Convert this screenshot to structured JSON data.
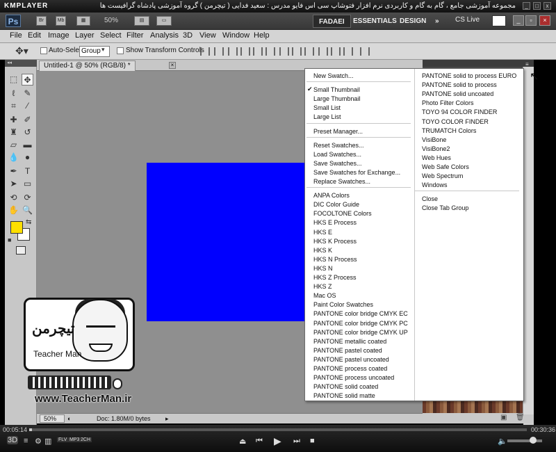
{
  "player": {
    "logo": "KMPLAYER",
    "title": "مجموعه آموزشی جامع ، گام به گام و کاربردی نرم افزار فتوشاپ سی اس فایو مدرس : سعید فدایی ( تیچرمن ) گروه آموزشی پادشاه گرافیست ها",
    "time_elapsed": "00:05:14",
    "time_total": "00:30:36",
    "formats": [
      "FLV",
      "MP3",
      "3D",
      "2CH"
    ]
  },
  "appbar": {
    "logo": "Ps",
    "br": "Br",
    "mb": "Mb",
    "zoom": "50%",
    "workspaces": [
      "FADAEI",
      "ESSENTIALS",
      "DESIGN"
    ],
    "more": "»",
    "cs_live": "CS Live"
  },
  "menubar": [
    "File",
    "Edit",
    "Image",
    "Layer",
    "Select",
    "Filter",
    "Analysis",
    "3D",
    "View",
    "Window",
    "Help"
  ],
  "options": {
    "auto_select_label": "Auto-Select:",
    "auto_select_value": "Group",
    "show_transform_label": "Show Transform Controls"
  },
  "document": {
    "tab_title": "Untitled-1 @ 50% (RGB/8) *",
    "zoom": "50%",
    "doc_info": "Doc: 1.80M/0 bytes",
    "canvas_color": "#0000ff"
  },
  "colors": {
    "foreground": "#ffe000",
    "background": "#ffffff"
  },
  "flyout": {
    "col1": [
      {
        "label": "New Swatch...",
        "sep_after": true
      },
      {
        "label": "Small Thumbnail",
        "checked": true
      },
      {
        "label": "Large Thumbnail"
      },
      {
        "label": "Small List"
      },
      {
        "label": "Large List",
        "sep_after": true
      },
      {
        "label": "Preset Manager...",
        "sep_after": true
      },
      {
        "label": "Reset Swatches..."
      },
      {
        "label": "Load Swatches..."
      },
      {
        "label": "Save Swatches..."
      },
      {
        "label": "Save Swatches for Exchange..."
      },
      {
        "label": "Replace Swatches...",
        "sep_after": true
      },
      {
        "label": "ANPA Colors"
      },
      {
        "label": "DIC Color Guide"
      },
      {
        "label": "FOCOLTONE Colors"
      },
      {
        "label": "HKS E Process"
      },
      {
        "label": "HKS E"
      },
      {
        "label": "HKS K Process"
      },
      {
        "label": "HKS K"
      },
      {
        "label": "HKS N Process"
      },
      {
        "label": "HKS N"
      },
      {
        "label": "HKS Z Process"
      },
      {
        "label": "HKS Z"
      },
      {
        "label": "Mac OS"
      },
      {
        "label": "Paint Color Swatches"
      },
      {
        "label": "PANTONE color bridge CMYK EC"
      },
      {
        "label": "PANTONE color bridge CMYK PC"
      },
      {
        "label": "PANTONE color bridge CMYK UP"
      },
      {
        "label": "PANTONE metallic coated"
      },
      {
        "label": "PANTONE pastel coated"
      },
      {
        "label": "PANTONE pastel uncoated"
      },
      {
        "label": "PANTONE process coated"
      },
      {
        "label": "PANTONE process uncoated"
      },
      {
        "label": "PANTONE solid coated"
      },
      {
        "label": "PANTONE solid matte"
      }
    ],
    "col2": [
      {
        "label": "PANTONE solid to process EURO"
      },
      {
        "label": "PANTONE solid to process"
      },
      {
        "label": "PANTONE solid uncoated"
      },
      {
        "label": "Photo Filter Colors"
      },
      {
        "label": "TOYO 94 COLOR FINDER"
      },
      {
        "label": "TOYO COLOR FINDER"
      },
      {
        "label": "TRUMATCH Colors"
      },
      {
        "label": "VisiBone"
      },
      {
        "label": "VisiBone2"
      },
      {
        "label": "Web Hues"
      },
      {
        "label": "Web Safe Colors"
      },
      {
        "label": "Web Spectrum"
      },
      {
        "label": "Windows",
        "sep_after": true
      },
      {
        "label": "Close"
      },
      {
        "label": "Close Tab Group"
      }
    ]
  },
  "watermark": {
    "logo_text": "تیچرمن",
    "tagline": "Teacher Man",
    "url": "www.TeacherMan.ir"
  }
}
